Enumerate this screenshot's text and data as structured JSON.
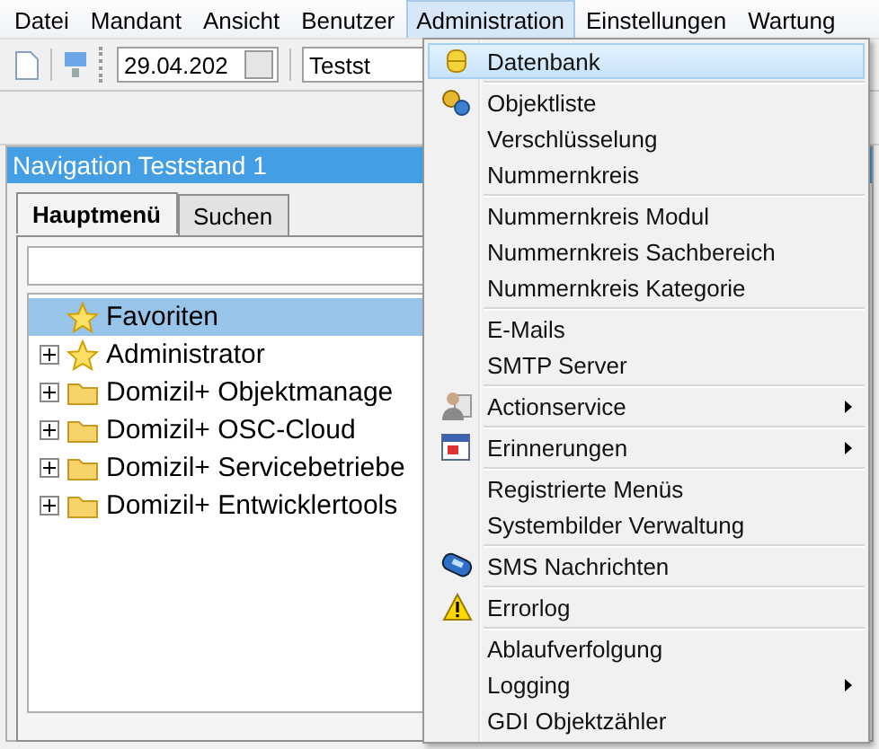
{
  "menubar": [
    {
      "label": "Datei",
      "selected": false
    },
    {
      "label": "Mandant",
      "selected": false
    },
    {
      "label": "Ansicht",
      "selected": false
    },
    {
      "label": "Benutzer",
      "selected": false
    },
    {
      "label": "Administration",
      "selected": true
    },
    {
      "label": "Einstellungen",
      "selected": false
    },
    {
      "label": "Wartung",
      "selected": false
    }
  ],
  "toolbar": {
    "date_field": "29.04.202",
    "combo_field": "Testst"
  },
  "panel": {
    "title": "Navigation Teststand 1",
    "tabs": [
      {
        "label": "Hauptmenü",
        "selected": true
      },
      {
        "label": "Suchen",
        "selected": false
      }
    ],
    "tree": [
      {
        "label": "Favoriten",
        "kind": "star",
        "selected": true,
        "expandable": false
      },
      {
        "label": "Administrator",
        "kind": "star",
        "selected": false,
        "expandable": true
      },
      {
        "label": "Domizil+ Objektmanage",
        "kind": "folder",
        "selected": false,
        "expandable": true
      },
      {
        "label": "Domizil+ OSC-Cloud",
        "kind": "folder",
        "selected": false,
        "expandable": true
      },
      {
        "label": "Domizil+ Servicebetriebe",
        "kind": "folder",
        "selected": false,
        "expandable": true
      },
      {
        "label": "Domizil+ Entwicklertools",
        "kind": "folder",
        "selected": false,
        "expandable": true
      }
    ]
  },
  "dropdown": [
    [
      {
        "label": "Datenbank",
        "kind": "database",
        "selected": true,
        "submenu": false
      }
    ],
    [
      {
        "label": "Objektliste",
        "kind": "gears",
        "selected": false,
        "submenu": false
      },
      {
        "label": "Verschlüsselung",
        "selected": false,
        "submenu": false
      },
      {
        "label": "Nummernkreis",
        "selected": false,
        "submenu": false
      }
    ],
    [
      {
        "label": "Nummernkreis Modul",
        "selected": false,
        "submenu": false
      },
      {
        "label": "Nummernkreis Sachbereich",
        "selected": false,
        "submenu": false
      },
      {
        "label": "Nummernkreis Kategorie",
        "selected": false,
        "submenu": false
      }
    ],
    [
      {
        "label": "E-Mails",
        "selected": false,
        "submenu": false
      },
      {
        "label": "SMTP Server",
        "selected": false,
        "submenu": false
      }
    ],
    [
      {
        "label": "Actionservice",
        "kind": "person",
        "selected": false,
        "submenu": true
      }
    ],
    [
      {
        "label": "Erinnerungen",
        "kind": "calendar",
        "selected": false,
        "submenu": true
      }
    ],
    [
      {
        "label": "Registrierte Menüs",
        "selected": false,
        "submenu": false
      },
      {
        "label": "Systembilder Verwaltung",
        "selected": false,
        "submenu": false
      }
    ],
    [
      {
        "label": "SMS Nachrichten",
        "kind": "phone",
        "selected": false,
        "submenu": false
      }
    ],
    [
      {
        "label": "Errorlog",
        "kind": "warning",
        "selected": false,
        "submenu": false
      }
    ],
    [
      {
        "label": "Ablaufverfolgung",
        "selected": false,
        "submenu": false
      },
      {
        "label": "Logging",
        "selected": false,
        "submenu": true
      },
      {
        "label": "GDI Objektzähler",
        "selected": false,
        "submenu": false
      }
    ]
  ]
}
